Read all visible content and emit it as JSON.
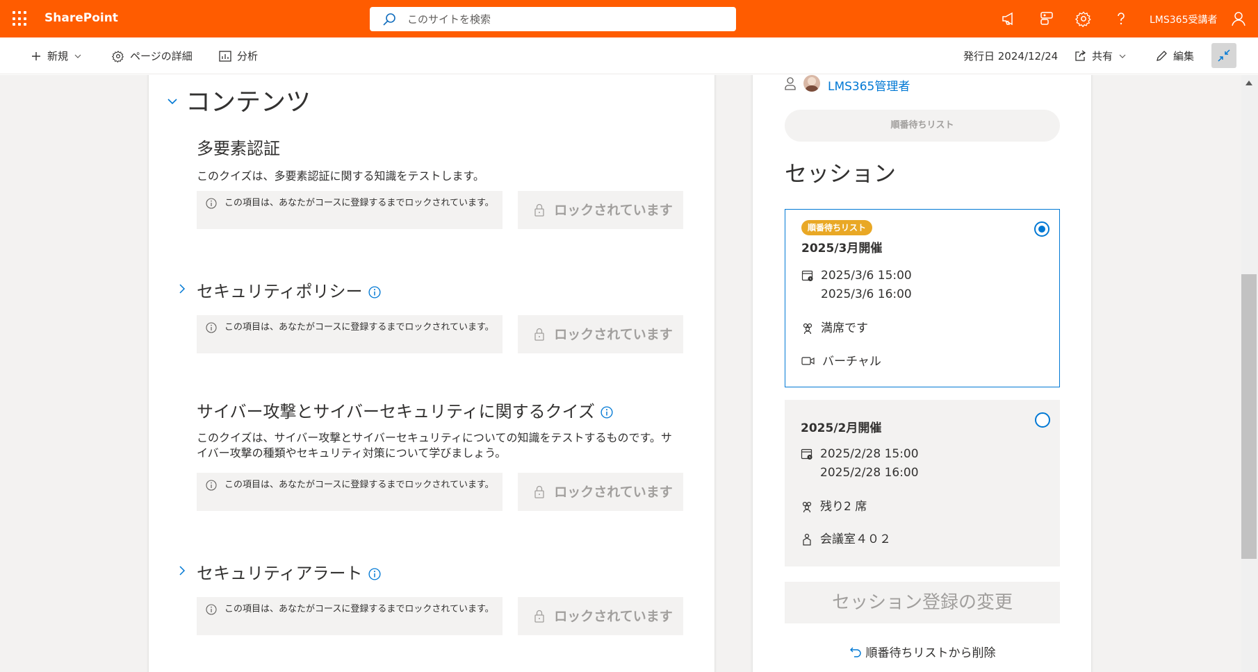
{
  "app": {
    "name": "SharePoint"
  },
  "search": {
    "placeholder": "このサイトを検索"
  },
  "header": {
    "username": "LMS365受講者"
  },
  "commandbar": {
    "new_label": "新規",
    "page_details_label": "ページの詳細",
    "analytics_label": "分析",
    "published": "発行日 2024/12/24",
    "share_label": "共有",
    "edit_label": "編集"
  },
  "content": {
    "section_title": "コンテンツ",
    "lock_message": "この項目は、あなたがコースに登録するまでロックされています。",
    "locked_label": "ロックされています",
    "items": [
      {
        "title": "多要素認証",
        "description": "このクイズは、多要素認証に関する知識をテストします。"
      },
      {
        "title": "セキュリティポリシー",
        "description": ""
      },
      {
        "title": "サイバー攻撃とサイバーセキュリティに関するクイズ",
        "description": "このクイズは、サイバー攻撃とサイバーセキュリティについての知識をテストするものです。サイバー攻撃の種類やセキュリティ対策について学びましょう。"
      },
      {
        "title": "セキュリティアラート",
        "description": ""
      }
    ]
  },
  "sidebar": {
    "instructor_name": "LMS365管理者",
    "waitlist_button": "順番待ちリスト",
    "sessions_title": "セッション",
    "sessions": [
      {
        "badge": "順番待ちリスト",
        "title": "2025/3月開催",
        "start": "2025/3/6 15:00",
        "end": "2025/3/6 16:00",
        "seats": "満席です",
        "location": "バーチャル",
        "selected": true
      },
      {
        "badge": "",
        "title": "2025/2月開催",
        "start": "2025/2/28 15:00",
        "end": "2025/2/28 16:00",
        "seats": "残り2 席",
        "location": "会議室４０２",
        "selected": false
      }
    ],
    "change_registration": "セッション登録の変更",
    "remove_waitlist": "順番待ちリストから削除"
  },
  "colors": {
    "brand": "#ff5c00",
    "accent": "#0078d4",
    "badge": "#e9a825"
  }
}
